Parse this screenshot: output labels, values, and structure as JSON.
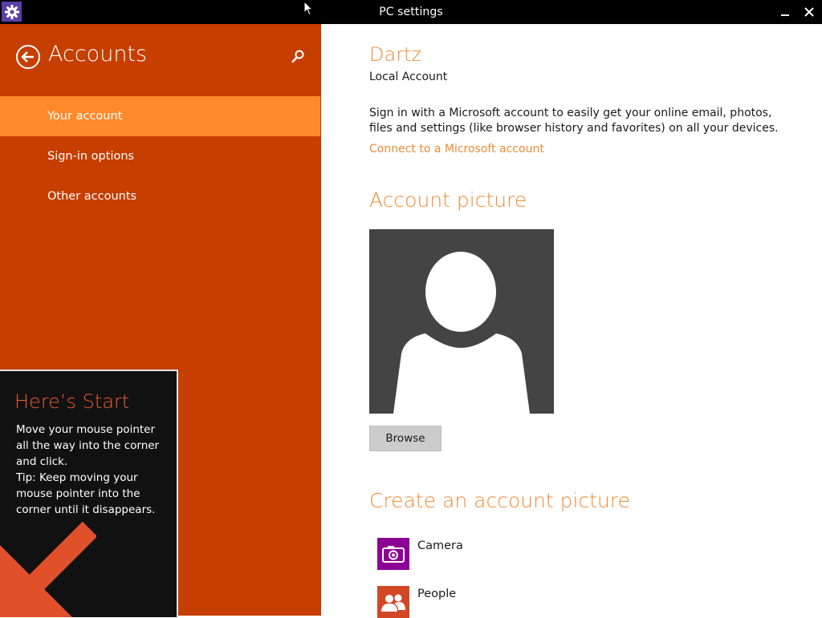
{
  "window": {
    "title": "PC settings",
    "app_icon": "gear-icon",
    "minimize_icon": "minimize-icon",
    "close_icon": "close-icon"
  },
  "nav": {
    "title": "Accounts",
    "back_icon": "back-arrow-icon",
    "search_icon": "search-icon",
    "items": [
      {
        "label": "Your account",
        "selected": true
      },
      {
        "label": "Sign-in options",
        "selected": false
      },
      {
        "label": "Other accounts",
        "selected": false
      }
    ]
  },
  "tip": {
    "title": "Here’s Start",
    "lines": [
      "Move your mouse pointer",
      "all the way into the corner",
      "and click.",
      "Tip: Keep moving your",
      "mouse pointer into the",
      "corner until it disappears."
    ],
    "arrow_icon": "corner-arrow-icon"
  },
  "account": {
    "name": "Dartz",
    "type": "Local Account",
    "description": "Sign in with a Microsoft account to easily get your online email, photos, files and settings (like browser history and favorites) on all your devices.",
    "link": "Connect to a Microsoft account"
  },
  "picture": {
    "title": "Account picture",
    "avatar_icon": "user-silhouette-icon",
    "browse_label": "Browse"
  },
  "create": {
    "title": "Create an account picture",
    "apps": [
      {
        "label": "Camera",
        "icon": "camera-icon",
        "tile_color": "#8c0095"
      },
      {
        "label": "People",
        "icon": "people-icon",
        "tile_color": "#d24726"
      }
    ]
  },
  "colors": {
    "nav_bg": "#c63e00",
    "nav_selected": "#ff8a2b",
    "accent": "#f08a33",
    "titlebar": "#000000",
    "tip_bg": "#111111",
    "tip_title": "#e8602c"
  }
}
